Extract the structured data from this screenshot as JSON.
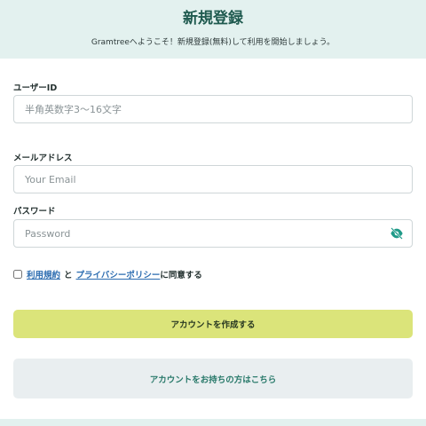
{
  "header": {
    "title": "新規登録",
    "subtitle": "Gramtreeへようこそ！新規登録(無料)して利用を開始しましょう。"
  },
  "form": {
    "user_id": {
      "label": "ユーザーID",
      "placeholder": "半角英数字3〜16文字",
      "value": ""
    },
    "email": {
      "label": "メールアドレス",
      "placeholder": "Your Email",
      "value": ""
    },
    "password": {
      "label": "パスワード",
      "placeholder": "Password",
      "value": ""
    },
    "agreement": {
      "terms_link": "利用規約",
      "and": "と",
      "privacy_link": "プライバシーポリシー",
      "suffix": "に同意する",
      "checked": false
    }
  },
  "buttons": {
    "create_account": "アカウントを作成する",
    "have_account": "アカウントをお持ちの方はこちら"
  },
  "icons": {
    "password_toggle": "eye-off-icon"
  },
  "colors": {
    "header_bg": "#e3f1ef",
    "primary_button": "#dbe47a",
    "secondary_button": "#e9eef0",
    "accent_teal": "#1f9a88",
    "link": "#2b6cb0"
  }
}
